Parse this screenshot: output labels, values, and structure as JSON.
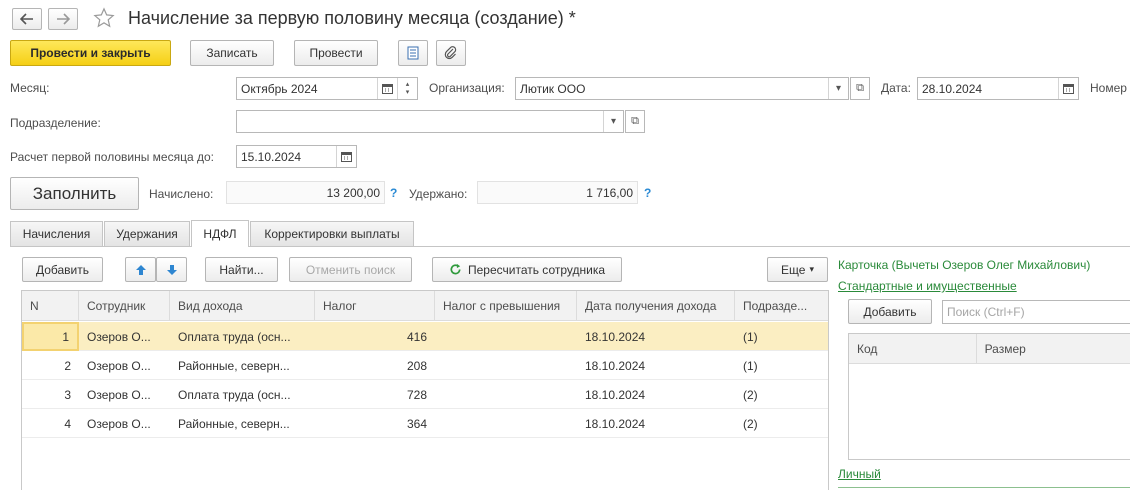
{
  "header": {
    "title": "Начисление за первую половину месяца (создание) *"
  },
  "toolbar": {
    "post_close": "Провести и закрыть",
    "save": "Записать",
    "post": "Провести"
  },
  "form": {
    "month_label": "Месяц:",
    "month_value": "Октябрь 2024",
    "org_label": "Организация:",
    "org_value": "Лютик ООО",
    "date_label": "Дата:",
    "date_value": "28.10.2024",
    "number_label": "Номер",
    "division_label": "Подразделение:",
    "division_value": "",
    "calc_until_label": "Расчет первой половины месяца до:",
    "calc_until_value": "15.10.2024",
    "fill_button": "Заполнить",
    "accrued_label": "Начислено:",
    "accrued_value": "13 200,00",
    "withheld_label": "Удержано:",
    "withheld_value": "1 716,00",
    "help": "?"
  },
  "tabs": [
    "Начисления",
    "Удержания",
    "НДФЛ",
    "Корректировки выплаты"
  ],
  "active_tab": "НДФЛ",
  "grid_toolbar": {
    "add": "Добавить",
    "find": "Найти...",
    "cancel_search": "Отменить поиск",
    "recalc": "Пересчитать сотрудника",
    "more": "Еще"
  },
  "grid": {
    "columns": [
      "N",
      "Сотрудник",
      "Вид дохода",
      "Налог",
      "Налог с превышения",
      "Дата получения дохода",
      "Подразде..."
    ],
    "rows": [
      [
        "1",
        "Озеров О...",
        "Оплата труда (осн...",
        "416",
        "",
        "18.10.2024",
        "(1)"
      ],
      [
        "2",
        "Озеров О...",
        "Районные, северн...",
        "208",
        "",
        "18.10.2024",
        "(1)"
      ],
      [
        "3",
        "Озеров О...",
        "Оплата труда (осн...",
        "728",
        "",
        "18.10.2024",
        "(2)"
      ],
      [
        "4",
        "Озеров О...",
        "Районные, северн...",
        "364",
        "",
        "18.10.2024",
        "(2)"
      ]
    ]
  },
  "side": {
    "card_title": "Карточка (Вычеты Озеров Олег Михайлович)",
    "standard_link": "Стандартные и имущественные",
    "add": "Добавить",
    "search_placeholder": "Поиск (Ctrl+F)",
    "col_code": "Код",
    "col_size": "Размер",
    "personal_link": "Личный"
  },
  "colors": {
    "accent_yellow": "#f5cf15",
    "link_green": "#2a8a3a",
    "selected_row": "#fbeec2",
    "help_blue": "#2a8ad4"
  },
  "icons": [
    "back-arrow-icon",
    "forward-arrow-icon",
    "star-icon",
    "document-icon",
    "paperclip-icon",
    "calendar-icon",
    "spin-icon",
    "dropdown-icon",
    "open-icon",
    "move-up-icon",
    "move-down-icon",
    "refresh-icon"
  ]
}
